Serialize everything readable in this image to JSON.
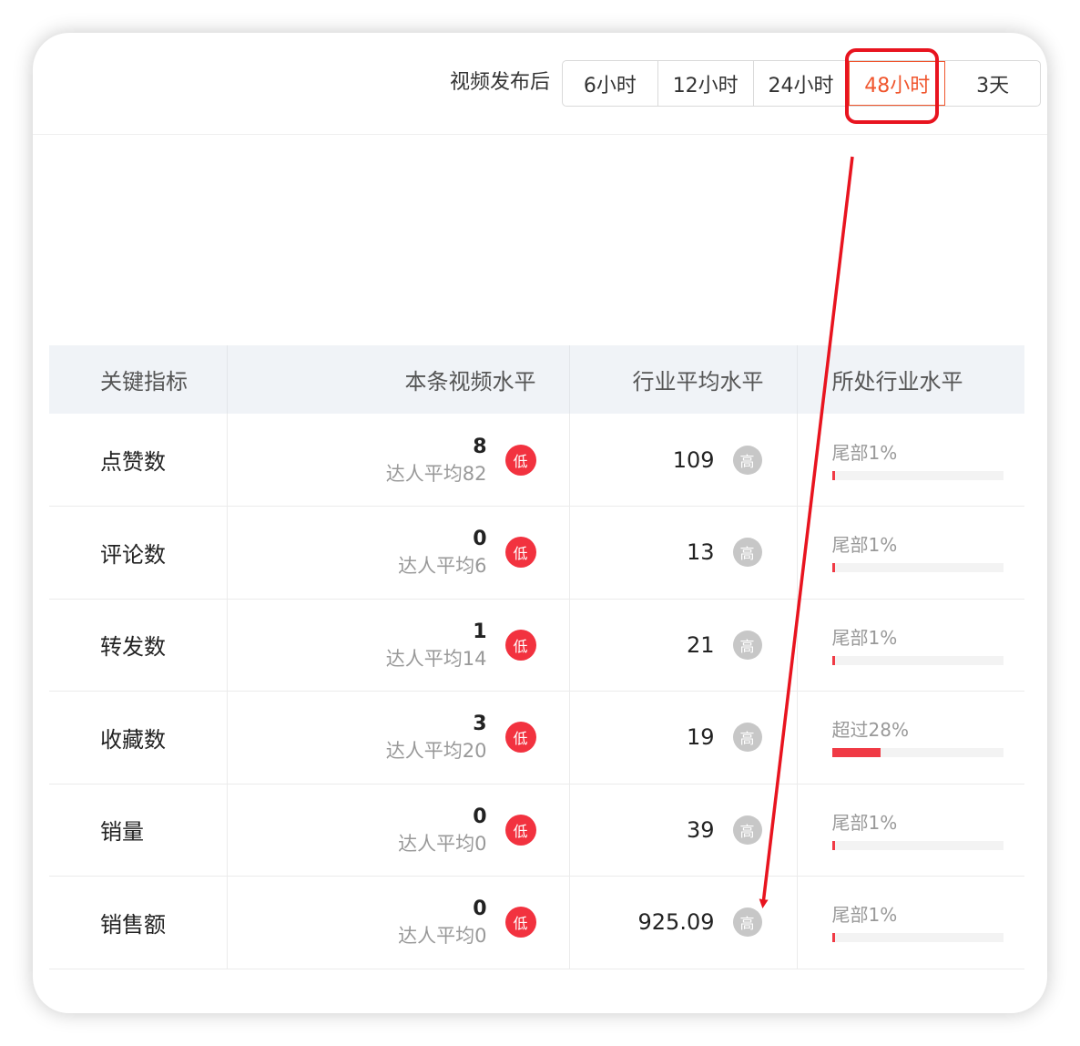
{
  "filter": {
    "label": "视频发布后",
    "options": [
      "6小时",
      "12小时",
      "24小时",
      "48小时",
      "3天"
    ],
    "selected_index": 3
  },
  "table": {
    "headers": [
      "关键指标",
      "本条视频水平",
      "行业平均水平",
      "所处行业水平"
    ],
    "rows": [
      {
        "metric": "点赞数",
        "value": "8",
        "avg": "达人平均82",
        "low_badge": "低",
        "industry": "109",
        "high_badge": "高",
        "level": "尾部1%",
        "level_fraction": 0.01
      },
      {
        "metric": "评论数",
        "value": "0",
        "avg": "达人平均6",
        "low_badge": "低",
        "industry": "13",
        "high_badge": "高",
        "level": "尾部1%",
        "level_fraction": 0.01
      },
      {
        "metric": "转发数",
        "value": "1",
        "avg": "达人平均14",
        "low_badge": "低",
        "industry": "21",
        "high_badge": "高",
        "level": "尾部1%",
        "level_fraction": 0.01
      },
      {
        "metric": "收藏数",
        "value": "3",
        "avg": "达人平均20",
        "low_badge": "低",
        "industry": "19",
        "high_badge": "高",
        "level": "超过28%",
        "level_fraction": 0.28
      },
      {
        "metric": "销量",
        "value": "0",
        "avg": "达人平均0",
        "low_badge": "低",
        "industry": "39",
        "high_badge": "高",
        "level": "尾部1%",
        "level_fraction": 0.01
      },
      {
        "metric": "销售额",
        "value": "0",
        "avg": "达人平均0",
        "low_badge": "低",
        "industry": "925.09",
        "high_badge": "高",
        "level": "尾部1%",
        "level_fraction": 0.01
      }
    ]
  },
  "colors": {
    "accent": "#f0562e",
    "annotation": "#e8141f",
    "low_badge": "#f2323f",
    "high_badge": "#c7c7c7",
    "bar_fill": "#f03a45"
  }
}
